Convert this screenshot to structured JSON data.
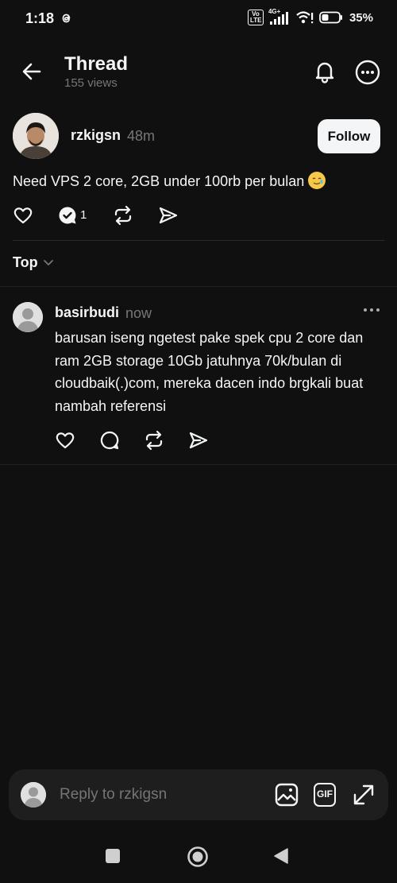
{
  "status_bar": {
    "time": "1:18",
    "network": "4G+",
    "volte": "Vo LTE",
    "battery": "35%"
  },
  "header": {
    "title": "Thread",
    "views": "155 views"
  },
  "post": {
    "username": "rzkigsn",
    "time_ago": "48m",
    "follow_label": "Follow",
    "text": "Need VPS 2 core, 2GB under 100rb per bulan",
    "emoji": "smiling-face-with-tear",
    "reply_count": "1"
  },
  "sort": {
    "label": "Top"
  },
  "reply": {
    "username": "basirbudi",
    "time_ago": "now",
    "text": "barusan iseng ngetest pake spek cpu 2 core dan ram 2GB storage 10Gb jatuhnya 70k/bulan di cloudbaik(.)com, mereka dacen indo brgkali buat nambah referensi"
  },
  "reply_bar": {
    "placeholder": "Reply to rzkigsn",
    "gif_label": "GIF"
  },
  "icons": {
    "back": "arrow-left-icon",
    "bell": "bell-icon",
    "more": "more-circle-icon",
    "like": "heart-icon",
    "reply": "comment-icon",
    "repost": "repost-icon",
    "share": "send-icon",
    "image": "image-icon",
    "expand": "expand-icon"
  }
}
